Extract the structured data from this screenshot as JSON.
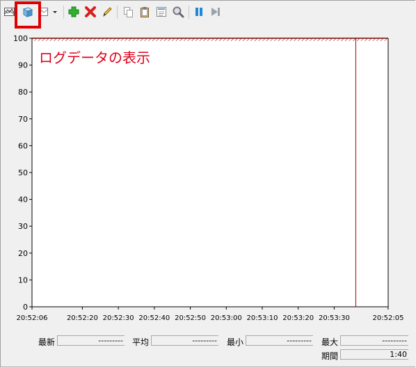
{
  "toolbar": {
    "items": [
      {
        "name": "change-graph-type-button",
        "icon": "line-graph-icon"
      },
      {
        "name": "view-log-data-button",
        "icon": "cube-icon"
      },
      {
        "name": "view-current-activity-button",
        "icon": "graph-dropdown-icon"
      },
      {
        "name": "add-counter-button",
        "icon": "plus-icon"
      },
      {
        "name": "delete-counter-button",
        "icon": "x-icon"
      },
      {
        "name": "highlight-button",
        "icon": "pencil-icon"
      },
      {
        "name": "copy-properties-button",
        "icon": "copy-icon"
      },
      {
        "name": "paste-counter-list-button",
        "icon": "clipboard-icon"
      },
      {
        "name": "properties-button",
        "icon": "properties-icon"
      },
      {
        "name": "zoom-button",
        "icon": "magnifier-icon"
      },
      {
        "name": "freeze-display-button",
        "icon": "pause-icon"
      },
      {
        "name": "update-data-button",
        "icon": "step-forward-icon"
      }
    ]
  },
  "annotation": "ログデータの表示",
  "chart_data": {
    "type": "line",
    "title": "",
    "xlabel": "",
    "ylabel": "",
    "ylim": [
      0,
      100
    ],
    "y_ticks": [
      "0",
      "10",
      "20",
      "30",
      "40",
      "50",
      "60",
      "70",
      "80",
      "90",
      "100"
    ],
    "x_tick_labels": [
      "20:52:06",
      "20:52:20",
      "20:52:30",
      "20:52:40",
      "20:52:50",
      "20:53:00",
      "20:53:10",
      "20:53:20",
      "20:53:30",
      "20:52:05"
    ],
    "x_tick_seconds": [
      0,
      14,
      24,
      34,
      44,
      54,
      64,
      74,
      84,
      99
    ],
    "time_cursor_seconds": 90,
    "series": [],
    "grid": false,
    "colors": {
      "cursor": "#b00000",
      "annotation": "#e0001b",
      "top_hatch": "#7a0000"
    }
  },
  "stats": {
    "latest_label": "最新",
    "latest_value": "---------",
    "average_label": "平均",
    "average_value": "---------",
    "minimum_label": "最小",
    "minimum_value": "---------",
    "maximum_label": "最大",
    "maximum_value": "---------",
    "duration_label": "期間",
    "duration_value": "1:40"
  }
}
